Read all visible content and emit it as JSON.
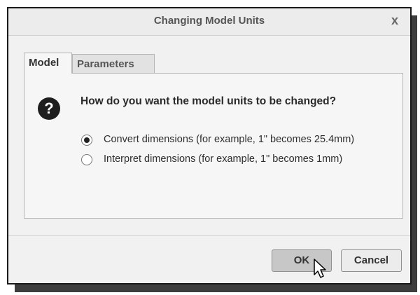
{
  "dialog": {
    "title": "Changing Model Units",
    "close_glyph": "x"
  },
  "tabs": [
    {
      "label": "Model",
      "active": true
    },
    {
      "label": "Parameters",
      "active": false
    }
  ],
  "content": {
    "icon": "question-icon",
    "icon_glyph": "?",
    "question": "How do you want the model units to be changed?",
    "options": [
      {
        "label": "Convert dimensions (for example, 1\" becomes 25.4mm)",
        "selected": true
      },
      {
        "label": "Interpret dimensions (for example, 1\" becomes 1mm)",
        "selected": false
      }
    ]
  },
  "buttons": {
    "ok": "OK",
    "cancel": "Cancel"
  },
  "colors": {
    "dialog_bg": "#f1f1f1",
    "ok_pressed_bg": "#c7c7c7"
  }
}
